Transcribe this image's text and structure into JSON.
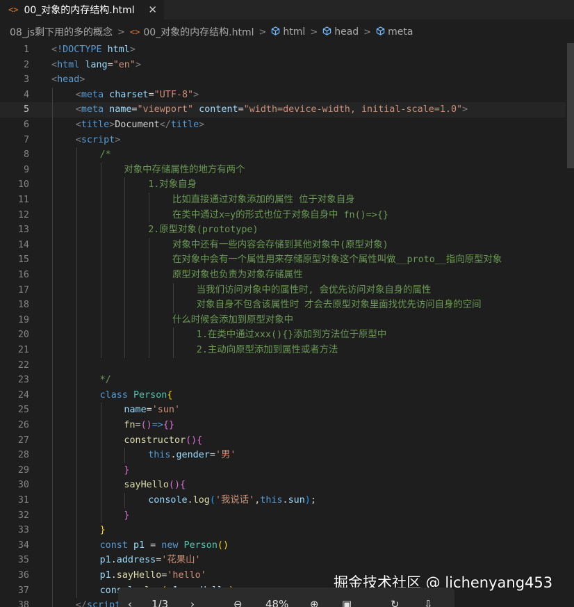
{
  "tab": {
    "title": "00_对象的内存结构.html",
    "file_icon": "<>",
    "close_icon": "✕"
  },
  "breadcrumb": {
    "folder": "08_js剩下用的多的概念",
    "file": "00_对象的内存结构.html",
    "html_node": "html",
    "head_node": "head",
    "meta_node": "meta",
    "separator": ">"
  },
  "editor": {
    "current_line": 5,
    "lines": [
      {
        "n": "1",
        "indent": 0,
        "tokens": [
          [
            "punct",
            "<"
          ],
          [
            "tag",
            "!DOCTYPE"
          ],
          [
            "text",
            " "
          ],
          [
            "attr",
            "html"
          ],
          [
            "punct",
            ">"
          ]
        ]
      },
      {
        "n": "2",
        "indent": 0,
        "tokens": [
          [
            "punct",
            "<"
          ],
          [
            "tag",
            "html"
          ],
          [
            "text",
            " "
          ],
          [
            "attr",
            "lang"
          ],
          [
            "text",
            "="
          ],
          [
            "str",
            "\"en\""
          ],
          [
            "punct",
            ">"
          ]
        ]
      },
      {
        "n": "3",
        "indent": 0,
        "tokens": [
          [
            "punct",
            "<"
          ],
          [
            "tag",
            "head"
          ],
          [
            "punct",
            ">"
          ]
        ]
      },
      {
        "n": "4",
        "indent": 1,
        "tokens": [
          [
            "punct",
            "<"
          ],
          [
            "tag",
            "meta"
          ],
          [
            "text",
            " "
          ],
          [
            "attr",
            "charset"
          ],
          [
            "text",
            "="
          ],
          [
            "str",
            "\"UTF-8\""
          ],
          [
            "punct",
            ">"
          ]
        ]
      },
      {
        "n": "5",
        "indent": 1,
        "tokens": [
          [
            "punct",
            "<"
          ],
          [
            "tag",
            "meta"
          ],
          [
            "text",
            " "
          ],
          [
            "attr",
            "name"
          ],
          [
            "text",
            "="
          ],
          [
            "str",
            "\"viewport\""
          ],
          [
            "text",
            " "
          ],
          [
            "attr",
            "content"
          ],
          [
            "text",
            "="
          ],
          [
            "str",
            "\"width=device-width, initial-scale=1.0\""
          ],
          [
            "punct",
            ">"
          ]
        ]
      },
      {
        "n": "6",
        "indent": 1,
        "tokens": [
          [
            "punct",
            "<"
          ],
          [
            "tag",
            "title"
          ],
          [
            "punct",
            ">"
          ],
          [
            "text",
            "Document"
          ],
          [
            "punct",
            "</"
          ],
          [
            "tag",
            "title"
          ],
          [
            "punct",
            ">"
          ]
        ]
      },
      {
        "n": "7",
        "indent": 1,
        "tokens": [
          [
            "punct",
            "<"
          ],
          [
            "tag",
            "script"
          ],
          [
            "punct",
            ">"
          ]
        ]
      },
      {
        "n": "8",
        "indent": 2,
        "tokens": [
          [
            "comment",
            "/*"
          ]
        ]
      },
      {
        "n": "9",
        "indent": 3,
        "tokens": [
          [
            "comment",
            "对象中存储属性的地方有两个"
          ]
        ]
      },
      {
        "n": "10",
        "indent": 4,
        "tokens": [
          [
            "comment",
            "1.对象自身"
          ]
        ]
      },
      {
        "n": "11",
        "indent": 5,
        "tokens": [
          [
            "comment",
            "比如直接通过对象添加的属性 位于对象自身"
          ]
        ]
      },
      {
        "n": "12",
        "indent": 5,
        "tokens": [
          [
            "comment",
            "在类中通过x=y的形式也位于对象自身中 fn()=>{}"
          ]
        ]
      },
      {
        "n": "13",
        "indent": 4,
        "tokens": [
          [
            "comment",
            "2.原型对象(prototype)"
          ]
        ]
      },
      {
        "n": "14",
        "indent": 5,
        "tokens": [
          [
            "comment",
            "对象中还有一些内容会存储到其他对象中(原型对象)"
          ]
        ]
      },
      {
        "n": "15",
        "indent": 5,
        "tokens": [
          [
            "comment",
            "在对象中会有一个属性用来存储原型对象这个属性叫做__proto__指向原型对象"
          ]
        ]
      },
      {
        "n": "16",
        "indent": 5,
        "tokens": [
          [
            "comment",
            "原型对象也负责为对象存储属性"
          ]
        ]
      },
      {
        "n": "17",
        "indent": 6,
        "tokens": [
          [
            "comment",
            "当我们访问对象中的属性时, 会优先访问对象自身的属性"
          ]
        ]
      },
      {
        "n": "18",
        "indent": 6,
        "tokens": [
          [
            "comment",
            "对象自身不包含该属性时 才会去原型对象里面找优先访问自身的空间"
          ]
        ]
      },
      {
        "n": "19",
        "indent": 5,
        "tokens": [
          [
            "comment",
            "什么时候会添加到原型对象中"
          ]
        ]
      },
      {
        "n": "20",
        "indent": 6,
        "tokens": [
          [
            "comment",
            "1.在类中通过xxx(){}添加到方法位于原型中"
          ]
        ]
      },
      {
        "n": "21",
        "indent": 6,
        "tokens": [
          [
            "comment",
            "2.主动向原型添加到属性或者方法"
          ]
        ]
      },
      {
        "n": "22",
        "indent": 2,
        "tokens": []
      },
      {
        "n": "23",
        "indent": 2,
        "tokens": [
          [
            "comment",
            "*/"
          ]
        ]
      },
      {
        "n": "24",
        "indent": 2,
        "tokens": [
          [
            "kw",
            "class"
          ],
          [
            "text",
            " "
          ],
          [
            "cls",
            "Person"
          ],
          [
            "brace1",
            "{"
          ]
        ]
      },
      {
        "n": "25",
        "indent": 3,
        "tokens": [
          [
            "prop",
            "name"
          ],
          [
            "op",
            "="
          ],
          [
            "str",
            "'sun'"
          ]
        ]
      },
      {
        "n": "26",
        "indent": 3,
        "tokens": [
          [
            "fn",
            "fn"
          ],
          [
            "op",
            "="
          ],
          [
            "brace2",
            "()"
          ],
          [
            "kw",
            "=>"
          ],
          [
            "brace2",
            "{}"
          ]
        ]
      },
      {
        "n": "27",
        "indent": 3,
        "tokens": [
          [
            "fn",
            "constructor"
          ],
          [
            "brace2",
            "(){"
          ]
        ]
      },
      {
        "n": "28",
        "indent": 4,
        "tokens": [
          [
            "kw",
            "this"
          ],
          [
            "text",
            "."
          ],
          [
            "prop",
            "gender"
          ],
          [
            "op",
            "="
          ],
          [
            "str",
            "'男'"
          ]
        ]
      },
      {
        "n": "29",
        "indent": 3,
        "tokens": [
          [
            "brace2",
            "}"
          ]
        ]
      },
      {
        "n": "30",
        "indent": 3,
        "tokens": [
          [
            "fn",
            "sayHello"
          ],
          [
            "brace2",
            "(){"
          ]
        ]
      },
      {
        "n": "31",
        "indent": 4,
        "tokens": [
          [
            "prop",
            "console"
          ],
          [
            "text",
            "."
          ],
          [
            "fn",
            "log"
          ],
          [
            "brace3",
            "("
          ],
          [
            "str",
            "'我说话'"
          ],
          [
            "text",
            ","
          ],
          [
            "kw",
            "this"
          ],
          [
            "text",
            "."
          ],
          [
            "prop",
            "sun"
          ],
          [
            "brace3",
            ")"
          ],
          [
            "text",
            ";"
          ]
        ]
      },
      {
        "n": "32",
        "indent": 3,
        "tokens": [
          [
            "brace2",
            "}"
          ]
        ]
      },
      {
        "n": "33",
        "indent": 2,
        "tokens": [
          [
            "brace1",
            "}"
          ]
        ]
      },
      {
        "n": "34",
        "indent": 2,
        "tokens": [
          [
            "kw",
            "const"
          ],
          [
            "text",
            " "
          ],
          [
            "prop",
            "p1"
          ],
          [
            "text",
            " "
          ],
          [
            "op",
            "="
          ],
          [
            "text",
            " "
          ],
          [
            "kw",
            "new"
          ],
          [
            "text",
            " "
          ],
          [
            "cls",
            "Person"
          ],
          [
            "brace1",
            "()"
          ]
        ]
      },
      {
        "n": "35",
        "indent": 2,
        "tokens": [
          [
            "prop",
            "p1"
          ],
          [
            "text",
            "."
          ],
          [
            "prop",
            "address"
          ],
          [
            "op",
            "="
          ],
          [
            "str",
            "'花果山'"
          ]
        ]
      },
      {
        "n": "36",
        "indent": 2,
        "tokens": [
          [
            "prop",
            "p1"
          ],
          [
            "text",
            "."
          ],
          [
            "fn",
            "sayHello"
          ],
          [
            "op",
            "="
          ],
          [
            "str",
            "'hello'"
          ]
        ]
      },
      {
        "n": "37",
        "indent": 2,
        "tokens": [
          [
            "prop",
            "console"
          ],
          [
            "text",
            "."
          ],
          [
            "fn",
            "log"
          ],
          [
            "brace1",
            "("
          ],
          [
            "prop",
            "p1"
          ],
          [
            "text",
            "."
          ],
          [
            "prop",
            "sayHello"
          ],
          [
            "brace1",
            ")"
          ],
          [
            "text",
            ";"
          ]
        ]
      },
      {
        "n": "38",
        "indent": 1,
        "tokens": [
          [
            "punct",
            "</"
          ],
          [
            "tag",
            "script"
          ],
          [
            "punct",
            ">"
          ]
        ]
      }
    ]
  },
  "watermark": "掘金技术社区 @ lichenyang453",
  "viewer_bar": {
    "prev_icon": "‹",
    "page": "1/3",
    "next_icon": "›",
    "zoom_out_icon": "⊖",
    "zoom": "48%",
    "zoom_in_icon": "⊕",
    "fit_icon": "▣",
    "rotate_icon": "↻",
    "download_icon": "⇩"
  }
}
